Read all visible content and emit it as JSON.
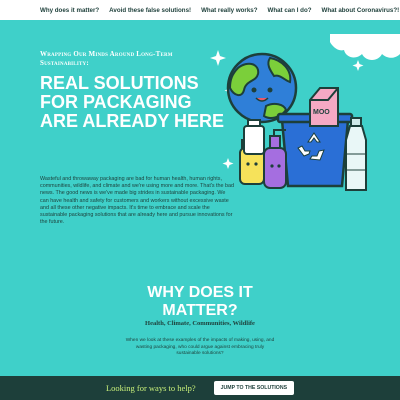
{
  "nav": {
    "items": [
      {
        "label": "Why does it matter?"
      },
      {
        "label": "Avoid these false solutions!"
      },
      {
        "label": "What really works?"
      },
      {
        "label": "What can I do?"
      },
      {
        "label": "What about Coronavirus?!"
      }
    ]
  },
  "hero": {
    "eyebrow": "Wrapping Our Minds Around Long-Term Sustainability:",
    "headline": "Real Solutions for Packaging Are Already Here",
    "body": "Wasteful and throwaway packaging are bad for human health, human rights, communities, wildlife, and climate and we're using more and more. That's the bad news. The good news is we've made big strides in sustainable packaging. We can have health and safety for customers and workers without excessive waste and all these other negative impacts. It's time to embrace and scale the sustainable packaging solutions that are already here and pursue innovations for the future.",
    "illustration_label": "MOO"
  },
  "why": {
    "title_line1": "Why does it",
    "title_line2": "matter?",
    "subtitle": "Health, Climate, Communities, Wildlife",
    "body": "When we look at these examples of the impacts of making, using, and wasting packaging, who could argue against embracing truly sustainable solutions?"
  },
  "bar": {
    "text": "Looking for ways to help?",
    "button": "Jump to the solutions"
  },
  "colors": {
    "background": "#3fd0c9",
    "dark": "#1d3f3a",
    "accent": "#c9f07a"
  }
}
